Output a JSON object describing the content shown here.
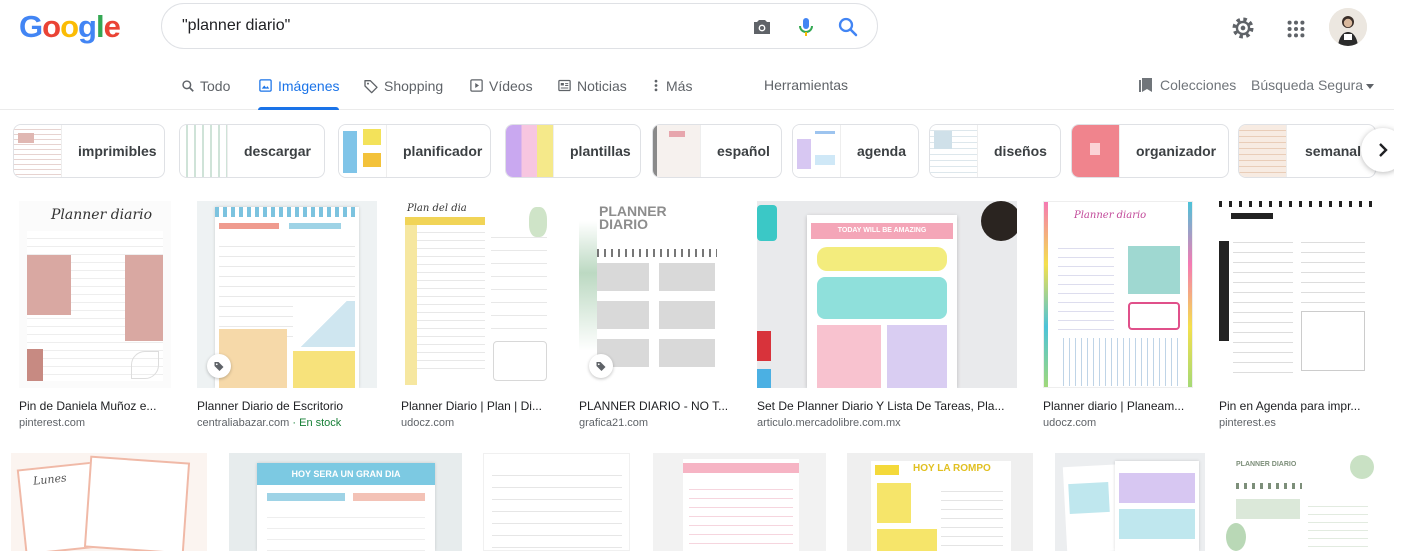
{
  "logo": {
    "letters": [
      "G",
      "o",
      "o",
      "g",
      "l",
      "e"
    ],
    "colors": [
      "#4285f4",
      "#ea4335",
      "#fbbc05",
      "#4285f4",
      "#34a853",
      "#ea4335"
    ]
  },
  "search": {
    "query": "\"planner diario\"",
    "icons": [
      "camera-icon",
      "microphone-icon",
      "search-icon"
    ]
  },
  "header": {
    "icons": [
      "gear-icon",
      "apps-grid-icon",
      "avatar"
    ]
  },
  "tabs": [
    {
      "label": "Todo",
      "icon": "search-icon",
      "active": false
    },
    {
      "label": "Imágenes",
      "icon": "image-icon",
      "active": true
    },
    {
      "label": "Shopping",
      "icon": "tag-icon",
      "active": false
    },
    {
      "label": "Vídeos",
      "icon": "play-icon",
      "active": false
    },
    {
      "label": "Noticias",
      "icon": "news-icon",
      "active": false
    },
    {
      "label": "Más",
      "icon": "more-vertical-icon",
      "active": false
    }
  ],
  "toolbar": {
    "tools": "Herramientas",
    "collections": "Colecciones",
    "safe_search": "Búsqueda Segura"
  },
  "chips": [
    {
      "label": "imprimibles"
    },
    {
      "label": "descargar"
    },
    {
      "label": "planificador"
    },
    {
      "label": "plantillas"
    },
    {
      "label": "español"
    },
    {
      "label": "agenda"
    },
    {
      "label": "diseños"
    },
    {
      "label": "organizador"
    },
    {
      "label": "semanal"
    }
  ],
  "results": [
    {
      "title": "Pin de Daniela Muñoz e...",
      "source": "pinterest.com",
      "stock": "",
      "thumb_text": "Planner diario"
    },
    {
      "title": "Planner Diario de Escritorio",
      "source": "centraliabazar.com",
      "stock": " · En stock",
      "thumb_text": ""
    },
    {
      "title": "Planner Diario | Plan | Di...",
      "source": "udocz.com",
      "stock": "",
      "thumb_text": "Plan del dia"
    },
    {
      "title": "PLANNER DIARIO - NO T...",
      "source": "grafica21.com",
      "stock": "",
      "thumb_text": "PLANNER DIARIO"
    },
    {
      "title": "Set De Planner Diario Y Lista De Tareas, Pla...",
      "source": "articulo.mercadolibre.com.mx",
      "stock": "",
      "thumb_text": "TODAY WILL BE AMAZING"
    },
    {
      "title": "Planner diario | Planeam...",
      "source": "udocz.com",
      "stock": "",
      "thumb_text": "Planner diario"
    },
    {
      "title": "Pin en Agenda para impr...",
      "source": "pinterest.es",
      "stock": "",
      "thumb_text": ""
    }
  ],
  "results_row2": [
    {
      "thumb_text": "Lunes"
    },
    {
      "thumb_text": "HOY SERA UN GRAN DIA"
    },
    {
      "thumb_text": ""
    },
    {
      "thumb_text": ""
    },
    {
      "thumb_text": "HOY LA ROMPO"
    },
    {
      "thumb_text": ""
    },
    {
      "thumb_text": "PLANNER DIARIO"
    }
  ]
}
